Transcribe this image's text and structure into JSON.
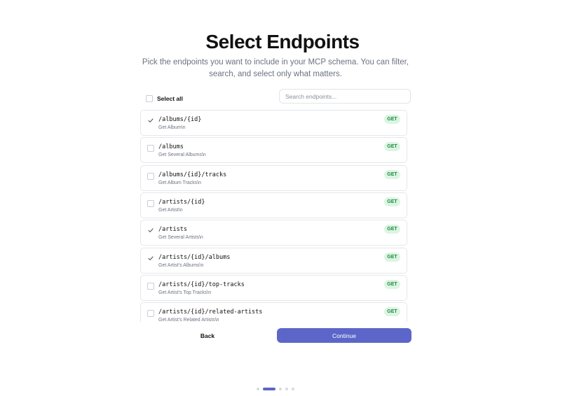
{
  "header": {
    "title": "Select Endpoints",
    "subtitle": "Pick the endpoints you want to include in your MCP schema. You can filter, search, and select only what matters."
  },
  "controls": {
    "select_all_label": "Select all",
    "search_placeholder": "Search endpoints...",
    "search_value": ""
  },
  "endpoints": [
    {
      "path": "/albums/{id}",
      "description": "Get Album\\n",
      "method": "GET",
      "selected": true
    },
    {
      "path": "/albums",
      "description": "Get Several Albums\\n",
      "method": "GET",
      "selected": false
    },
    {
      "path": "/albums/{id}/tracks",
      "description": "Get Album Tracks\\n",
      "method": "GET",
      "selected": false
    },
    {
      "path": "/artists/{id}",
      "description": "Get Artist\\n",
      "method": "GET",
      "selected": false
    },
    {
      "path": "/artists",
      "description": "Get Several Artists\\n",
      "method": "GET",
      "selected": true
    },
    {
      "path": "/artists/{id}/albums",
      "description": "Get Artist's Albums\\n",
      "method": "GET",
      "selected": true
    },
    {
      "path": "/artists/{id}/top-tracks",
      "description": "Get Artist's Top Tracks\\n",
      "method": "GET",
      "selected": false
    },
    {
      "path": "/artists/{id}/related-artists",
      "description": "Get Artist's Related Artists\\n",
      "method": "GET",
      "selected": false
    }
  ],
  "footer": {
    "back_label": "Back",
    "continue_label": "Continue"
  },
  "progress": {
    "total_steps": 5,
    "current_step": 2
  },
  "colors": {
    "accent": "#5c66c9",
    "method_get_text": "#1f8a3e",
    "method_get_bg": "#dcf5e3"
  },
  "icons": {
    "check": "check-icon"
  }
}
